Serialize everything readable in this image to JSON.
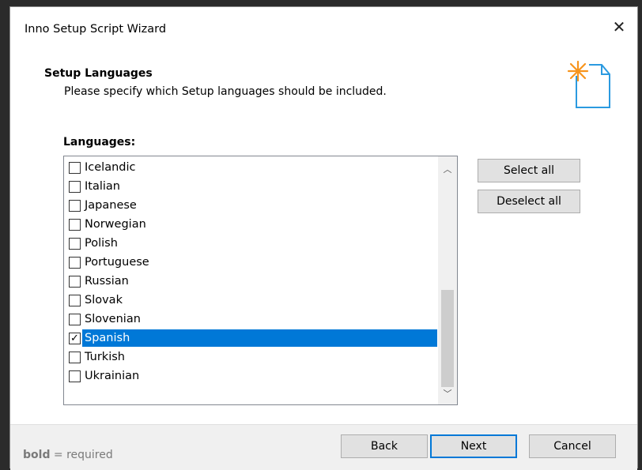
{
  "window": {
    "title": "Inno Setup Script Wizard",
    "close_glyph": "✕"
  },
  "header": {
    "title": "Setup Languages",
    "subtitle": "Please specify which Setup languages should be included."
  },
  "languages_label": "Languages:",
  "languages": [
    {
      "name": "Icelandic",
      "checked": false,
      "selected": false
    },
    {
      "name": "Italian",
      "checked": false,
      "selected": false
    },
    {
      "name": "Japanese",
      "checked": false,
      "selected": false
    },
    {
      "name": "Norwegian",
      "checked": false,
      "selected": false
    },
    {
      "name": "Polish",
      "checked": false,
      "selected": false
    },
    {
      "name": "Portuguese",
      "checked": false,
      "selected": false
    },
    {
      "name": "Russian",
      "checked": false,
      "selected": false
    },
    {
      "name": "Slovak",
      "checked": false,
      "selected": false
    },
    {
      "name": "Slovenian",
      "checked": false,
      "selected": false
    },
    {
      "name": "Spanish",
      "checked": true,
      "selected": true
    },
    {
      "name": "Turkish",
      "checked": false,
      "selected": false
    },
    {
      "name": "Ukrainian",
      "checked": false,
      "selected": false
    }
  ],
  "buttons": {
    "select_all": "Select all",
    "deselect_all": "Deselect all",
    "back": "Back",
    "next": "Next",
    "cancel": "Cancel"
  },
  "footer": {
    "hint_bold": "bold",
    "hint_rest": " = required"
  },
  "colors": {
    "selection": "#0078d7",
    "icon_accent": "#f7941d",
    "icon_outline": "#2b9ae0"
  },
  "icons": {
    "wizard": "new-document-star-icon",
    "check": "checkmark-icon",
    "scroll_up": "chevron-up-icon",
    "scroll_down": "chevron-down-icon"
  }
}
